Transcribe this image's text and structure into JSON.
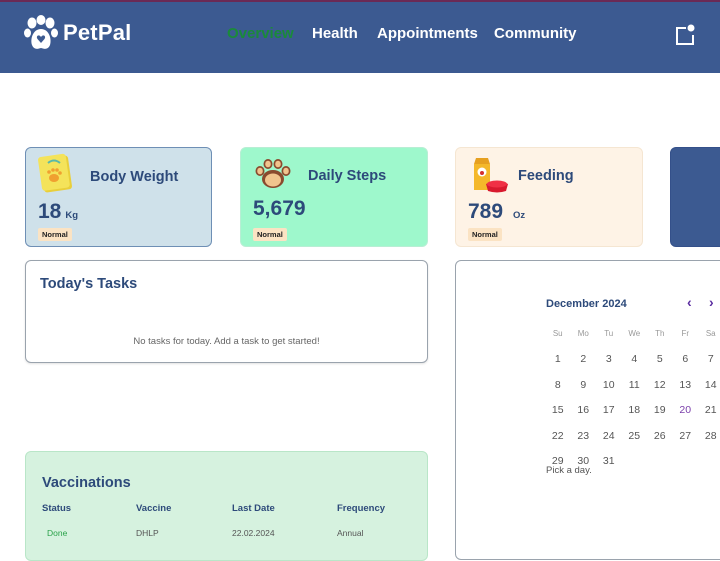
{
  "app": {
    "name": "PetPal",
    "logo_icon": "paw-heart-icon"
  },
  "nav": {
    "items": [
      {
        "label": "Overview",
        "active": true
      },
      {
        "label": "Health",
        "active": false
      },
      {
        "label": "Appointments",
        "active": false
      },
      {
        "label": "Community",
        "active": false
      }
    ],
    "active_color": "#1a8a3a",
    "notification_icon": "notification-icon"
  },
  "stats": {
    "weight": {
      "title": "Body Weight",
      "value": "18",
      "unit": "Kg",
      "status": "Normal",
      "icon": "scale-icon"
    },
    "steps": {
      "title": "Daily Steps",
      "value": "5,679",
      "unit": "",
      "status": "Normal",
      "icon": "paw-icon"
    },
    "feeding": {
      "title": "Feeding",
      "value": "789",
      "unit": "Oz",
      "status": "Normal",
      "icon": "food-bag-icon"
    }
  },
  "tasks": {
    "title": "Today's Tasks",
    "empty_message": "No tasks for today. Add a task to get started!"
  },
  "calendar": {
    "month_label": "December 2024",
    "prev_icon": "chevron-left-icon",
    "next_icon": "chevron-right-icon",
    "weekdays": [
      "Su",
      "Mo",
      "Tu",
      "We",
      "Th",
      "Fr",
      "Sa"
    ],
    "weeks": [
      [
        "1",
        "2",
        "3",
        "4",
        "5",
        "6",
        "7"
      ],
      [
        "8",
        "9",
        "10",
        "11",
        "12",
        "13",
        "14"
      ],
      [
        "15",
        "16",
        "17",
        "18",
        "19",
        "20",
        "21"
      ],
      [
        "22",
        "23",
        "24",
        "25",
        "26",
        "27",
        "28"
      ],
      [
        "29",
        "30",
        "31",
        "",
        "",
        "",
        ""
      ]
    ],
    "today": "20",
    "hint": "Pick a day."
  },
  "vaccinations": {
    "title": "Vaccinations",
    "columns": [
      "Status",
      "Vaccine",
      "Last Date",
      "Frequency"
    ],
    "rows": [
      {
        "status": "Done",
        "vaccine": "DHLP",
        "last_date": "22.02.2024",
        "frequency": "Annual"
      }
    ]
  },
  "colors": {
    "navbar": "#3c5a91",
    "heading": "#2d4a7a",
    "weight_card": "#cfe1ea",
    "steps_card": "#9ef8cc",
    "feeding_card": "#fef3e6",
    "vacc_card": "#d6f2df",
    "badge": "#fbe3c3"
  }
}
